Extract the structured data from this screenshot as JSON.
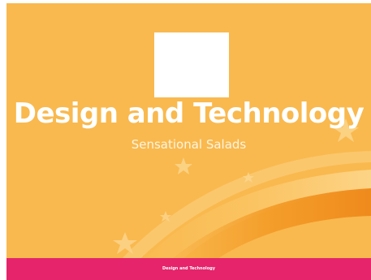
{
  "slide": {
    "title": "Design and Technology",
    "subtitle": "Sensational Salads",
    "footer": {
      "brand": "Design and Technology",
      "copyright": ""
    },
    "colors": {
      "background": "#f9b94e",
      "footer_bar": "#e5246b",
      "swoosh_light": "#fcd487",
      "swoosh_dark": "#f08a1f",
      "title_text": "#ffffff"
    },
    "decorations": [
      "star-icon",
      "swoosh-shape",
      "image-placeholder"
    ]
  }
}
